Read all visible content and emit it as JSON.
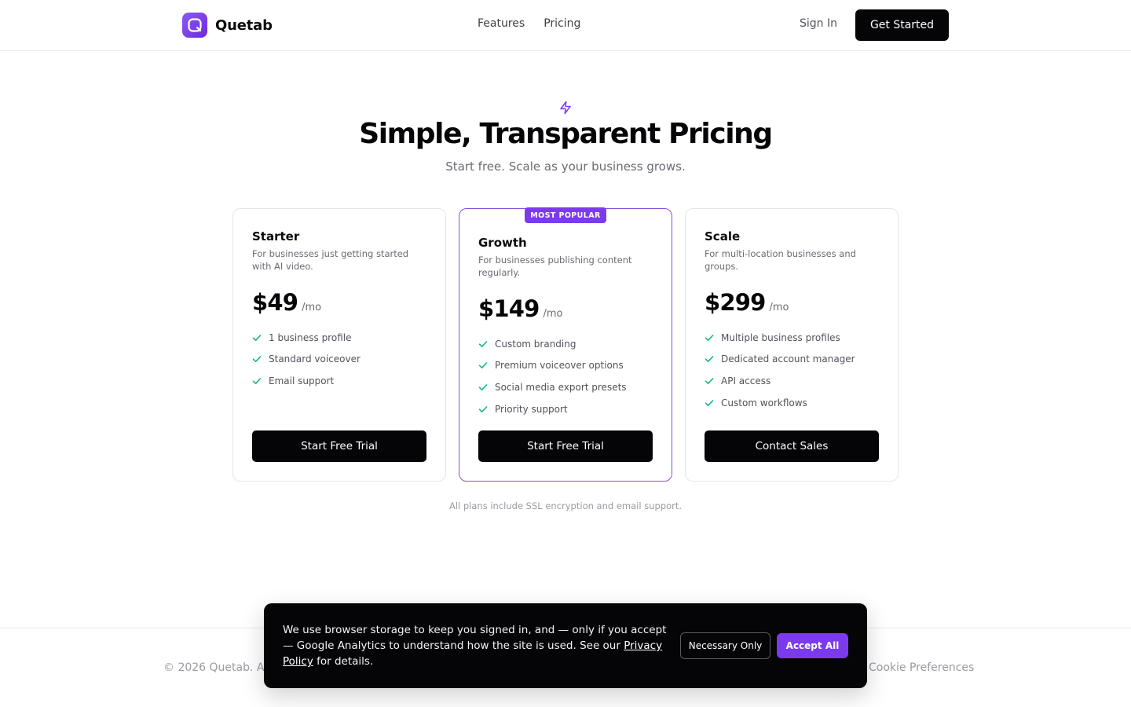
{
  "header": {
    "brand_name": "Quetab",
    "nav": [
      {
        "label": "Features"
      },
      {
        "label": "Pricing"
      }
    ],
    "signin_label": "Sign In",
    "cta_label": "Get Started"
  },
  "hero": {
    "icon": "lightning-bolt-icon",
    "title": "Simple, Transparent Pricing",
    "subtitle": "Start free. Scale as your business grows."
  },
  "plans": [
    {
      "name": "Starter",
      "description": "For businesses just getting started with AI video.",
      "price": "$49",
      "period": "/mo",
      "features": [
        "1 business profile",
        "Standard voiceover",
        "Email support"
      ],
      "cta": "Start Free Trial"
    },
    {
      "name": "Growth",
      "badge": "MOST POPULAR",
      "description": "For businesses publishing content regularly.",
      "price": "$149",
      "period": "/mo",
      "features": [
        "Custom branding",
        "Premium voiceover options",
        "Social media export presets",
        "Priority support"
      ],
      "cta": "Start Free Trial"
    },
    {
      "name": "Scale",
      "description": "For multi-location businesses and groups.",
      "price": "$299",
      "period": "/mo",
      "features": [
        "Multiple business profiles",
        "Dedicated account manager",
        "API access",
        "Custom workflows"
      ],
      "cta": "Contact Sales"
    }
  ],
  "note": "All plans include SSL encryption and email support.",
  "footer": {
    "copyright": "© 2026 Quetab. Al",
    "cookie_preferences": "Cookie Preferences"
  },
  "cookie_banner": {
    "text_before": "We use browser storage to keep you signed in, and — only if you accept — Google Analytics to understand how the site is used. See our ",
    "link": "Privacy Policy",
    "text_after": " for details.",
    "necessary_label": "Necessary Only",
    "accept_label": "Accept All"
  },
  "colors": {
    "accent": "#7c3aed",
    "check": "#10b981",
    "dark": "#050508"
  }
}
